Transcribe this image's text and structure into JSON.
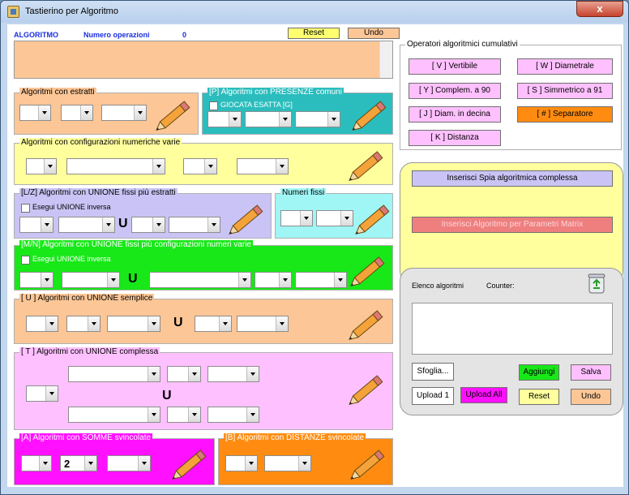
{
  "window": {
    "title": "Tastierino per Algoritmo",
    "close": "x"
  },
  "header": {
    "algoritmo": "ALGORITMO",
    "num_op_label": "Numero operazioni",
    "num_op_value": "0",
    "reset": "Reset",
    "undo": "Undo"
  },
  "p_estratti": {
    "title": "Algoritmi con estratti"
  },
  "p_presenze": {
    "title": "[P] Algoritmi con PRESENZE comuni",
    "check": "GIOCATA ESATTA  [G]"
  },
  "p_config": {
    "title": "Algoritmi con configurazioni numeriche varie"
  },
  "p_lz": {
    "title": "[L/Z] Algoritmi con UNIONE fissi più estratti",
    "check": "Esegui UNIONE inversa",
    "u": "U"
  },
  "p_fissi": {
    "title": "Numeri fissi"
  },
  "p_mn": {
    "title": "[M/N] Algoritmi con UNIONE fissi più configurazioni numeri varie",
    "check": "Esegui UNIONE inversa",
    "u": "U"
  },
  "p_u": {
    "title": "[ U ] Algoritmi con UNIONE semplice",
    "u": "U"
  },
  "p_t": {
    "title": "[ T ] Algoritmi con UNIONE complessa",
    "u": "U"
  },
  "p_a": {
    "title": "[A] Algoritmi con SOMME svincolate",
    "value": "2"
  },
  "p_b": {
    "title": "[B] Algoritmi con DISTANZE svincolate"
  },
  "operatori": {
    "title": "Operatori algoritmici cumulativi",
    "v": "[ V ] Vertibile",
    "w": "[ W ] Diametrale",
    "y": "[ Y ] Complem. a 90",
    "s": "[ S ] Simmetrico  a 91",
    "j": "[ J ] Diam. in decina",
    "sep": "[ # ] Separatore",
    "k": "[ K ] Distanza"
  },
  "spia": {
    "spia_btn": "Inserisci Spia algoritmica complessa",
    "matrix_btn": "Inserisci Algoritmo per Parametri Matrix"
  },
  "elenco": {
    "label": "Elenco algoritmi",
    "counter": "Counter:",
    "sfoglia": "Sfoglia...",
    "aggiungi": "Aggiungi",
    "salva": "Salva",
    "upload1": "Upload 1",
    "uploadall": "Upload All",
    "reset": "Reset",
    "undo": "Undo"
  },
  "colors": {
    "orange": "#fcc696",
    "yellow": "#ffff9e",
    "teal": "#2bbdbd",
    "lavender": "#c9c4f5",
    "cyan": "#a0f5f5",
    "green": "#18e818",
    "pink": "#ffc0ff",
    "magenta": "#ff10ff",
    "deeporange": "#ff8c10"
  }
}
